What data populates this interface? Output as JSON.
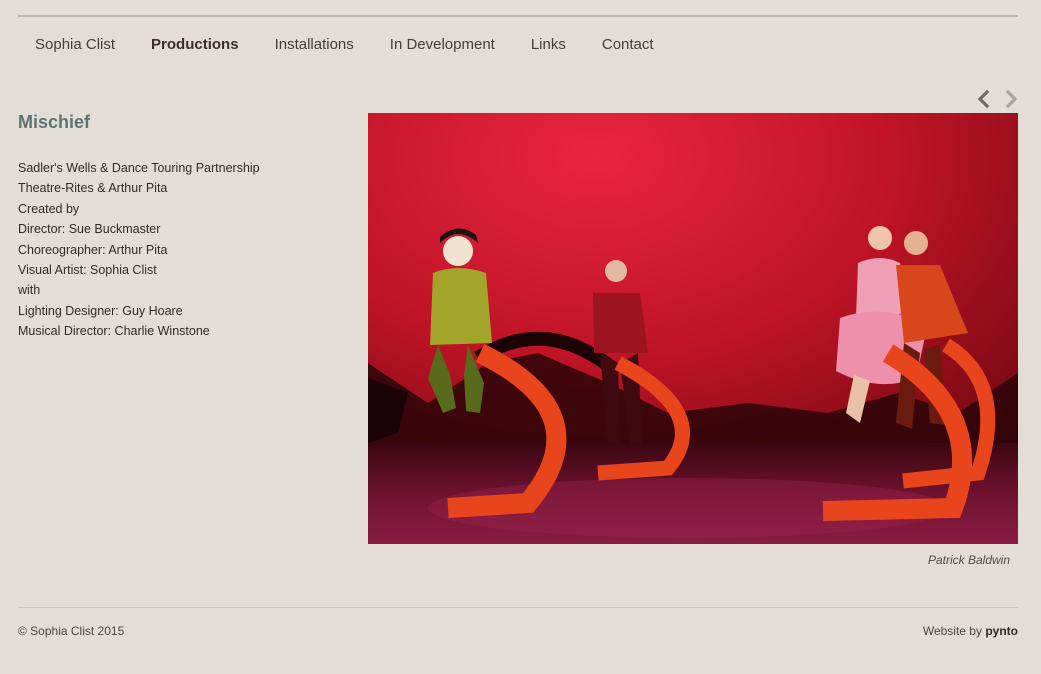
{
  "nav": {
    "items": [
      {
        "label": "Sophia Clist"
      },
      {
        "label": "Productions",
        "active": true
      },
      {
        "label": "Installations"
      },
      {
        "label": "In Development"
      },
      {
        "label": "Links"
      },
      {
        "label": "Contact"
      }
    ]
  },
  "project": {
    "title": "Mischief",
    "credits": [
      "Sadler's Wells & Dance Touring Partnership",
      "Theatre-Rites & Arthur Pita",
      "Created by",
      "Director: Sue Buckmaster",
      "Choreographer: Arthur Pita",
      "Visual Artist: Sophia Clist",
      "with",
      "Lighting Designer: Guy Hoare",
      "Musical Director: Charlie Winstone"
    ]
  },
  "slideshow": {
    "prev_icon": "chevron-left-icon",
    "next_icon": "chevron-right-icon",
    "photo_credit": "Patrick Baldwin"
  },
  "footer": {
    "copyright": "© Sophia Clist 2015",
    "website_by_prefix": "Website by ",
    "website_by_brand": "pynto"
  },
  "colors": {
    "background": "#e2ded5",
    "title": "#5f7373",
    "nav_text": "#433d3a"
  }
}
